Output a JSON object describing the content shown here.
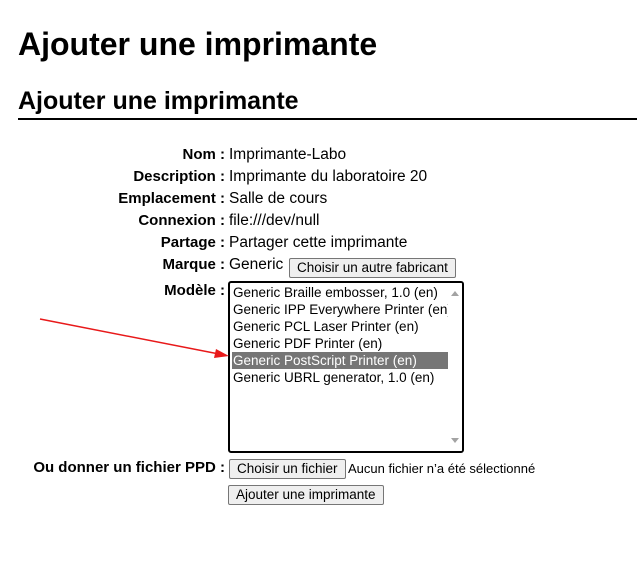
{
  "page": {
    "title": "Ajouter une imprimante",
    "subtitle": "Ajouter une imprimante"
  },
  "form": {
    "name": {
      "label": "Nom :",
      "value": "Imprimante-Labo"
    },
    "description": {
      "label": "Description :",
      "value": "Imprimante du laboratoire 20"
    },
    "location": {
      "label": "Emplacement :",
      "value": "Salle de cours"
    },
    "connection": {
      "label": "Connexion :",
      "value": "file:///dev/null"
    },
    "sharing": {
      "label": "Partage :",
      "value": "Partager cette imprimante"
    },
    "make": {
      "label": "Marque :",
      "value": "Generic",
      "button_label": "Choisir un autre fabricant"
    },
    "model": {
      "label": "Modèle :",
      "options": [
        "Generic Braille embosser, 1.0 (en)",
        "Generic IPP Everywhere Printer (en)",
        "Generic PCL Laser Printer (en)",
        "Generic PDF Printer (en)",
        "Generic PostScript Printer (en)",
        "Generic UBRL generator, 1.0 (en)"
      ],
      "selected": "Generic PostScript Printer (en)"
    },
    "ppd": {
      "label": "Ou donner un fichier PPD :",
      "button_label": "Choisir un fichier",
      "status": "Aucun fichier n’a été sélectionné"
    },
    "submit_label": "Ajouter une imprimante"
  },
  "colors": {
    "selected_option_bg": "#767676",
    "annotation_arrow": "#e8191a"
  }
}
